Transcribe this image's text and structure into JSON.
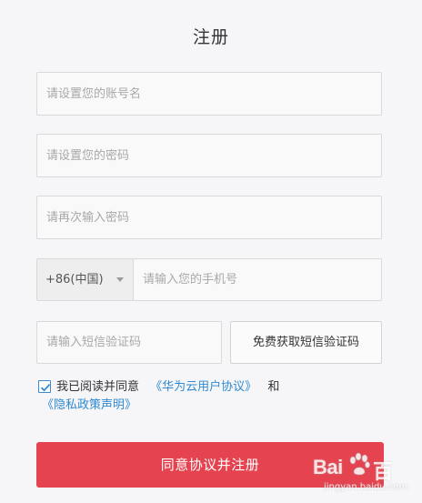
{
  "page": {
    "title": "注册"
  },
  "form": {
    "account_placeholder": "请设置您的账号名",
    "password_placeholder": "请设置您的密码",
    "confirm_placeholder": "请再次输入密码",
    "country_code": "+86(中国)",
    "phone_placeholder": "请输入您的手机号",
    "sms_placeholder": "请输入短信验证码",
    "sms_button": "免费获取短信验证码"
  },
  "agreement": {
    "checked": true,
    "prefix": "我已阅读并同意",
    "terms_link": "《华为云用户协议》",
    "conjunction": "和",
    "privacy_link": "《隐私政策声明》"
  },
  "submit_label": "同意协议并注册",
  "watermark": {
    "text_left": "Bai",
    "text_right": "百",
    "sub": "jingyan.baidu.com"
  },
  "colors": {
    "accent": "#e4434f",
    "link": "#2f8ad2",
    "background": "#f6f6f8",
    "field_border": "#d9d9d9"
  },
  "icons": {
    "checkbox": "checkmark-icon",
    "dropdown": "chevron-down-icon",
    "watermark": "paw-icon"
  }
}
